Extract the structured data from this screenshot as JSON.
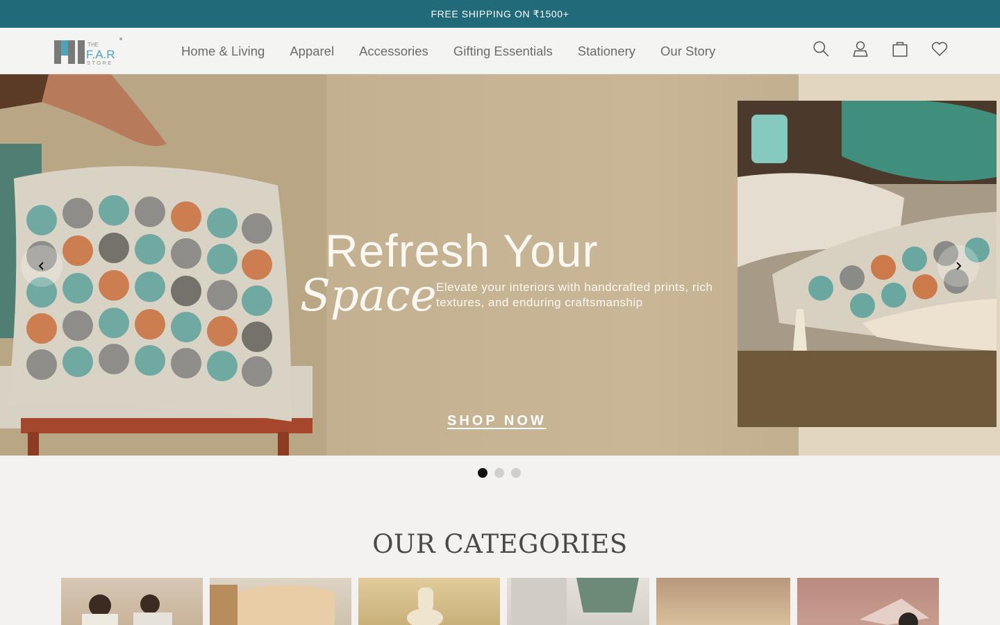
{
  "announcement": {
    "text": "FREE SHIPPING ON ₹1500+",
    "bg_color": "#206a7a"
  },
  "brand": {
    "logo_top": "THE",
    "logo_main": "F.A.R",
    "logo_bottom": "STORE",
    "accent_color": "#4ea3b8"
  },
  "nav": {
    "items": [
      {
        "label": "Home & Living"
      },
      {
        "label": "Apparel"
      },
      {
        "label": "Accessories"
      },
      {
        "label": "Gifting Essentials"
      },
      {
        "label": "Stationery"
      },
      {
        "label": "Our Story"
      }
    ]
  },
  "header_icons": [
    "search-icon",
    "account-icon",
    "cart-icon",
    "wishlist-icon"
  ],
  "hero": {
    "headline": "Refresh Your",
    "script": "Space",
    "subtext": "Elevate your interiors with handcrafted prints, rich textures, and enduring craftsmanship",
    "cta": "SHOP NOW",
    "prev_icon": "chevron-left-icon",
    "next_icon": "chevron-right-icon"
  },
  "slider": {
    "total": 3,
    "active": 1,
    "active_color": "#111111",
    "inactive_color": "#cfcfcf"
  },
  "categories": {
    "title": "OUR CATEGORIES",
    "cards": 6
  }
}
